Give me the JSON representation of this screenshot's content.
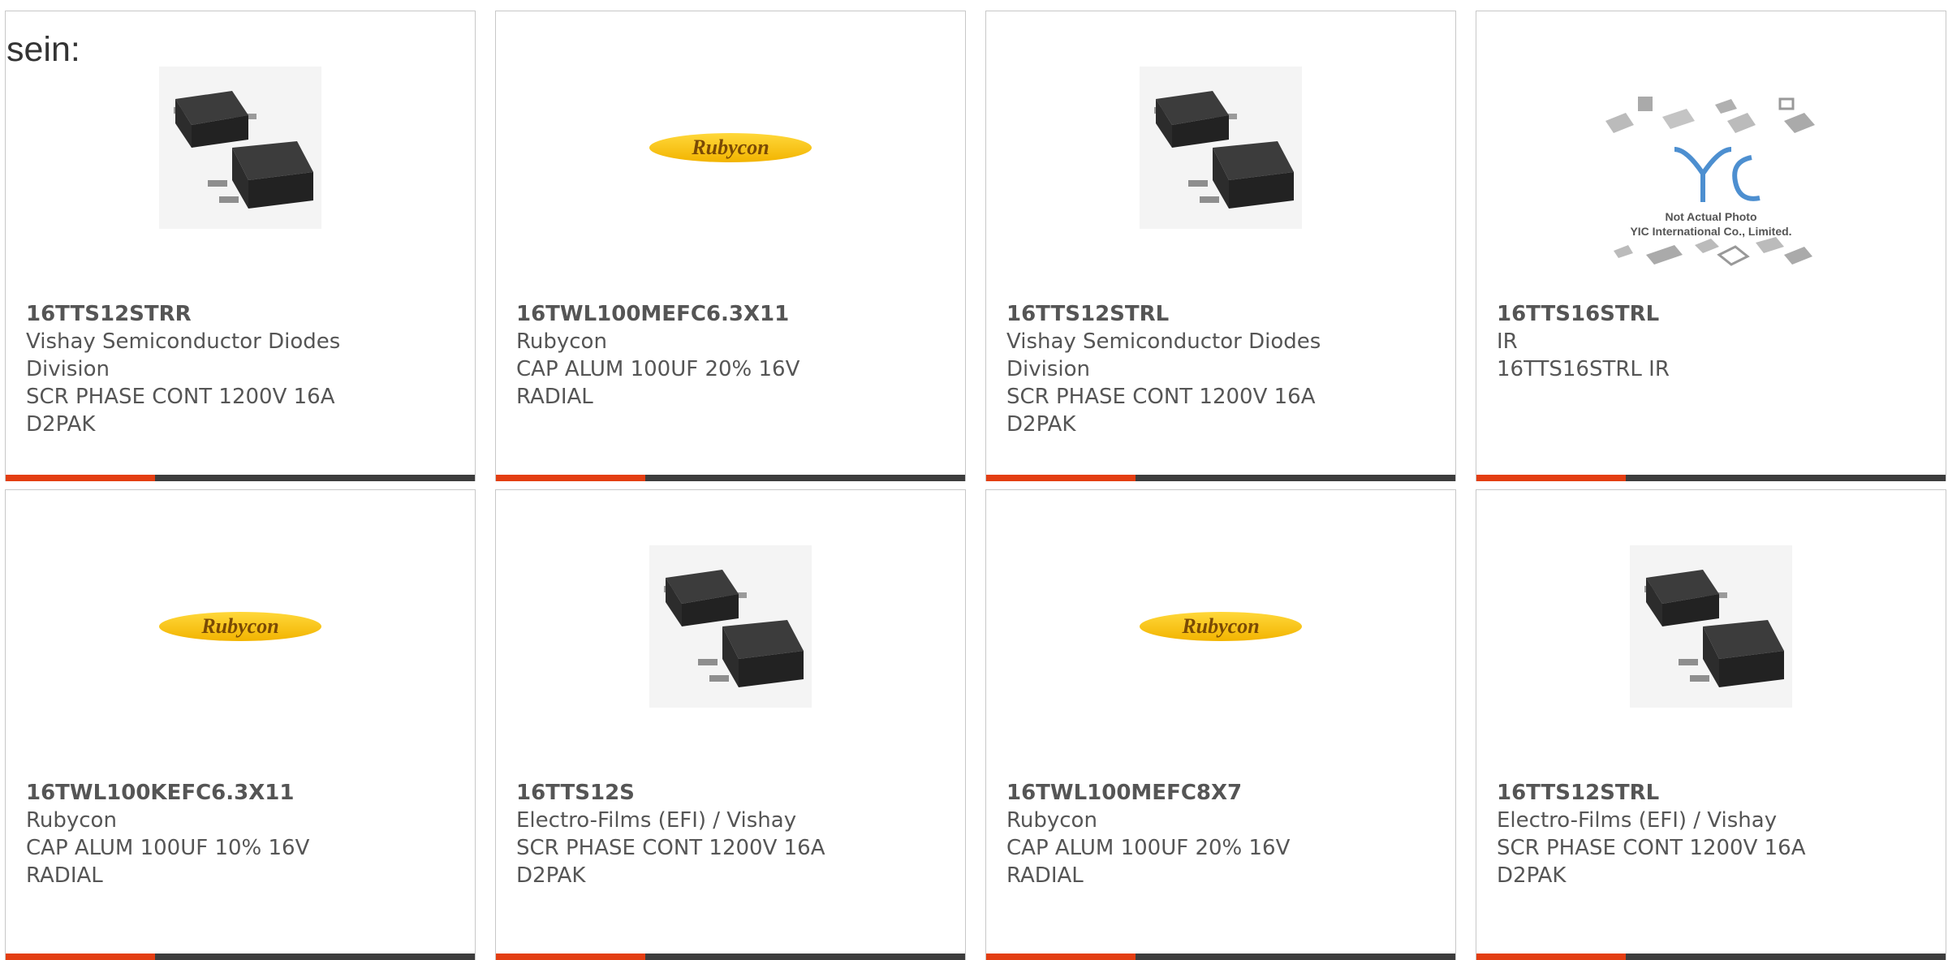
{
  "heading": "sein:",
  "cards": [
    {
      "part": "16TTS12STRR",
      "maker": "Vishay Semiconductor Diodes",
      "maker2": "Division",
      "desc": "SCR PHASE CONT 1200V 16A",
      "desc2": "D2PAK",
      "image": "d2pak-package"
    },
    {
      "part": "16TWL100MEFC6.3X11",
      "maker": "Rubycon",
      "maker2": "",
      "desc": "CAP ALUM 100UF 20% 16V",
      "desc2": "RADIAL",
      "image": "rubycon-logo"
    },
    {
      "part": "16TTS12STRL",
      "maker": "Vishay Semiconductor Diodes",
      "maker2": "Division",
      "desc": "SCR PHASE CONT 1200V 16A",
      "desc2": "D2PAK",
      "image": "d2pak-package"
    },
    {
      "part": "16TTS16STRL",
      "maker": "IR",
      "maker2": "",
      "desc": "16TTS16STRL IR",
      "desc2": "",
      "image": "yic-placeholder",
      "caption1": "Not Actual Photo",
      "caption2": "YIC International Co., Limited."
    },
    {
      "part": "16TWL100KEFC6.3X11",
      "maker": "Rubycon",
      "maker2": "",
      "desc": "CAP ALUM 100UF 10% 16V",
      "desc2": "RADIAL",
      "image": "rubycon-logo"
    },
    {
      "part": "16TTS12S",
      "maker": "Electro-Films (EFI) / Vishay",
      "maker2": "",
      "desc": "SCR PHASE CONT 1200V 16A",
      "desc2": "D2PAK",
      "image": "d2pak-package"
    },
    {
      "part": "16TWL100MEFC8X7",
      "maker": "Rubycon",
      "maker2": "",
      "desc": "CAP ALUM 100UF 20% 16V",
      "desc2": "RADIAL",
      "image": "rubycon-logo"
    },
    {
      "part": "16TTS12STRL",
      "maker": "Electro-Films (EFI) / Vishay",
      "maker2": "",
      "desc": "SCR PHASE CONT 1200V 16A",
      "desc2": "D2PAK",
      "image": "d2pak-package"
    }
  ],
  "logo_text": "Rubycon",
  "yic_mark": "YIC",
  "colors": {
    "accent": "#e33e12",
    "bar": "#3d3d3d",
    "border": "#c8c8c8",
    "text": "#555555",
    "logo_yellow": "#f2b400"
  }
}
